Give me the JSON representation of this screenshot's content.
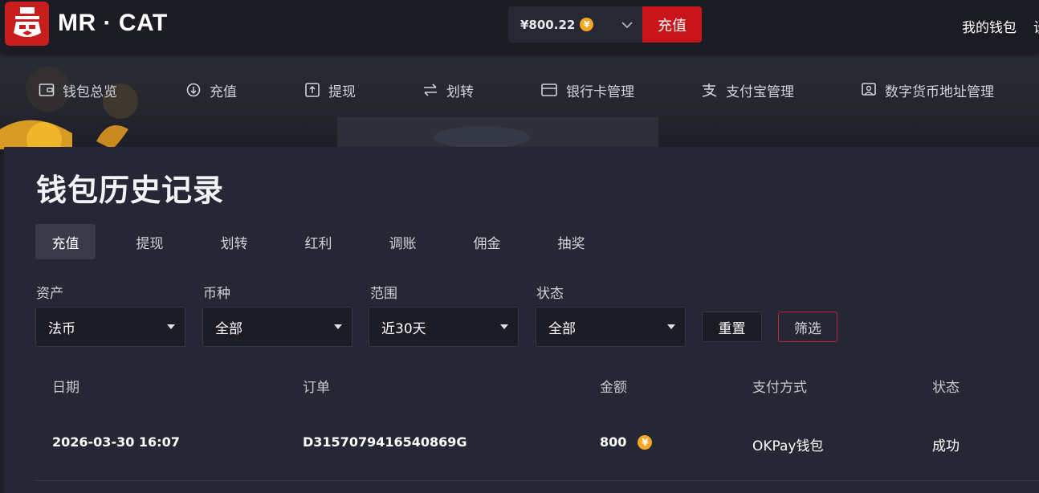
{
  "header": {
    "brand": "MR · CAT",
    "balance": "¥800.22",
    "balance_coin_symbol": "¥",
    "recharge_label": "充值",
    "wallet_link": "我的钱包",
    "cut_link": "设"
  },
  "subnav": {
    "items": [
      {
        "label": "钱包总览",
        "icon": "wallet-icon"
      },
      {
        "label": "充值",
        "icon": "deposit-icon"
      },
      {
        "label": "提现",
        "icon": "withdraw-icon"
      },
      {
        "label": "划转",
        "icon": "transfer-arrows-icon"
      },
      {
        "label": "银行卡管理",
        "icon": "bank-card-icon"
      },
      {
        "label": "支付宝管理",
        "icon": "alipay-icon"
      },
      {
        "label": "数字货币地址管理",
        "icon": "crypto-address-icon"
      }
    ]
  },
  "page": {
    "title": "钱包历史记录",
    "tabs": [
      "充值",
      "提现",
      "划转",
      "红利",
      "调账",
      "佣金",
      "抽奖"
    ],
    "active_tab": "充值"
  },
  "filters": {
    "asset": {
      "label": "资产",
      "value": "法币"
    },
    "currency": {
      "label": "币种",
      "value": "全部"
    },
    "range": {
      "label": "范围",
      "value": "近30天"
    },
    "status": {
      "label": "状态",
      "value": "全部"
    },
    "reset_label": "重置",
    "filter_label": "筛选"
  },
  "table": {
    "columns": [
      "日期",
      "订单",
      "金额",
      "支付方式",
      "状态"
    ],
    "rows": [
      {
        "date": "2026-03-30 16:07",
        "order": "D3157079416540869G",
        "amount": "800",
        "coin_symbol": "¥",
        "method": "OKPay钱包",
        "status": "成功"
      }
    ]
  },
  "colors": {
    "accent_red": "#c8151a",
    "coin_gold": "#f5a623",
    "panel_bg": "#262734",
    "topbar_bg": "#1a1b23"
  }
}
